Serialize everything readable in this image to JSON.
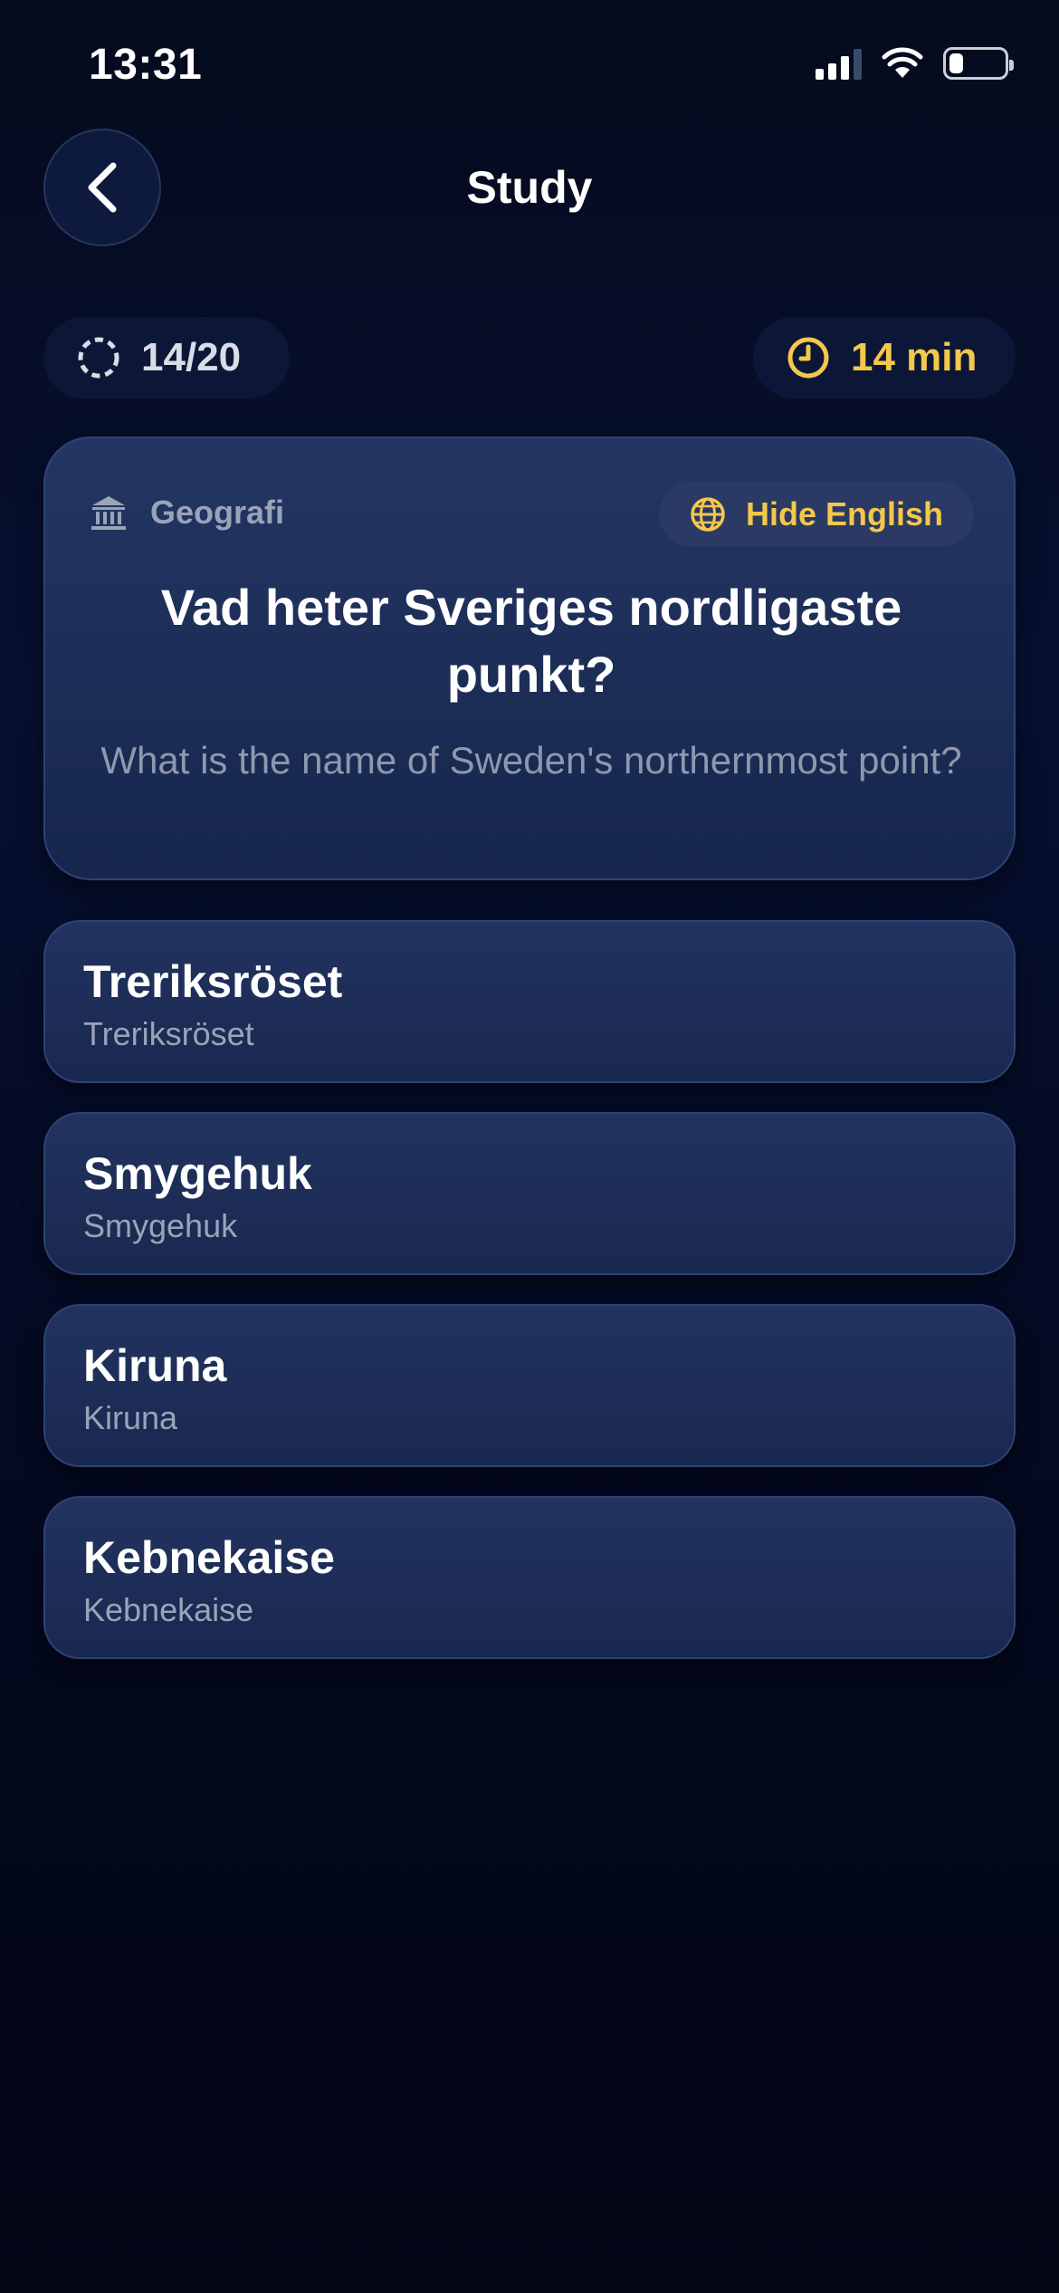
{
  "status_bar": {
    "time": "13:31"
  },
  "header": {
    "title": "Study"
  },
  "progress": {
    "label": "14/20"
  },
  "timer": {
    "label": "14 min"
  },
  "question": {
    "category": "Geografi",
    "toggle_label": "Hide English",
    "text_sv": "Vad heter Sveriges nordligaste punkt?",
    "text_en": "What is the name of Sweden's northernmost point?"
  },
  "options": [
    {
      "main": "Treriksröset",
      "sub": "Treriksröset"
    },
    {
      "main": "Smygehuk",
      "sub": "Smygehuk"
    },
    {
      "main": "Kiruna",
      "sub": "Kiruna"
    },
    {
      "main": "Kebnekaise",
      "sub": "Kebnekaise"
    }
  ],
  "colors": {
    "accent": "#f5c84a",
    "background": "#050b1d",
    "card": "#1c2d57"
  },
  "icons": {
    "back": "chevron-left-icon",
    "progress": "dashed-circle-icon",
    "timer": "clock-icon",
    "category": "museum-icon",
    "toggle": "globe-icon",
    "wifi": "wifi-icon",
    "signal": "cellular-signal-icon",
    "battery": "battery-icon"
  }
}
